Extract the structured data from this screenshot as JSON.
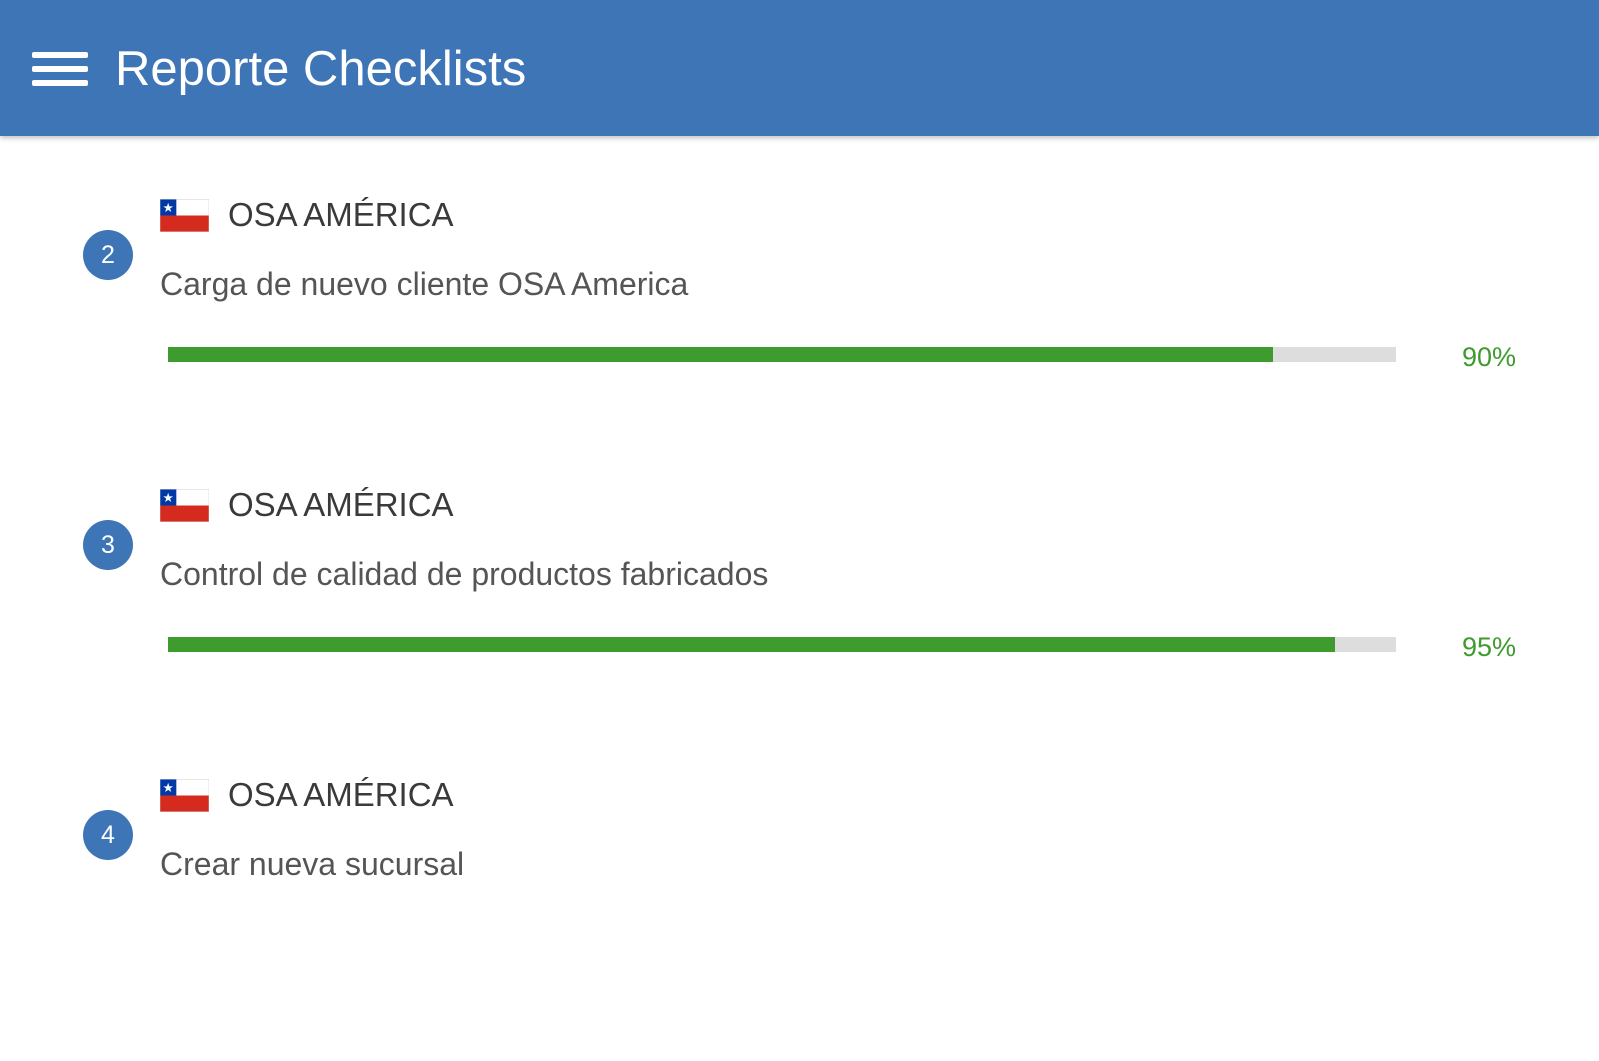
{
  "appbar": {
    "title": "Reporte Checklists",
    "menu_icon": "hamburger-menu-icon",
    "background": "#3e75b6"
  },
  "colors": {
    "accent": "#3e75b6",
    "progress": "#3e9b2e",
    "track": "#dddddd"
  },
  "items": [
    {
      "index": "2",
      "flag_icon": "chile-flag-icon",
      "company": "OSA AMÉRICA",
      "task": "Carga de nuevo cliente OSA America",
      "progress": 90,
      "progress_label": "90%"
    },
    {
      "index": "3",
      "flag_icon": "chile-flag-icon",
      "company": "OSA AMÉRICA",
      "task": "Control de calidad de productos fabricados",
      "progress": 95,
      "progress_label": "95%"
    },
    {
      "index": "4",
      "flag_icon": "chile-flag-icon",
      "company": "OSA AMÉRICA",
      "task": "Crear nueva sucursal"
    }
  ]
}
